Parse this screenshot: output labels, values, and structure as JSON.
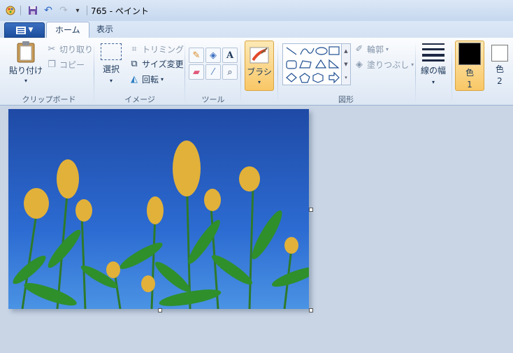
{
  "window": {
    "title": "765 - ペイント"
  },
  "tabs": [
    {
      "label": "ホーム"
    },
    {
      "label": "表示"
    }
  ],
  "clipboard": {
    "paste": "貼り付け",
    "cut": "切り取り",
    "copy": "コピー",
    "label": "クリップボード"
  },
  "image": {
    "select": "選択",
    "crop": "トリミング",
    "resize": "サイズ変更",
    "rotate": "回転",
    "label": "イメージ"
  },
  "tools": {
    "label": "ツール"
  },
  "brush": {
    "label": "ブラシ"
  },
  "shapes": {
    "outline": "輪郭",
    "fill": "塗りつぶし",
    "label": "図形"
  },
  "size": {
    "label": "線の幅"
  },
  "color1": {
    "label": "色",
    "num": "1",
    "value": "#000000"
  },
  "color2": {
    "label": "色",
    "num": "2",
    "value": "#ffffff"
  },
  "colors": {
    "accent_file": "#2a5db0",
    "active_brush": "#f9c766"
  }
}
